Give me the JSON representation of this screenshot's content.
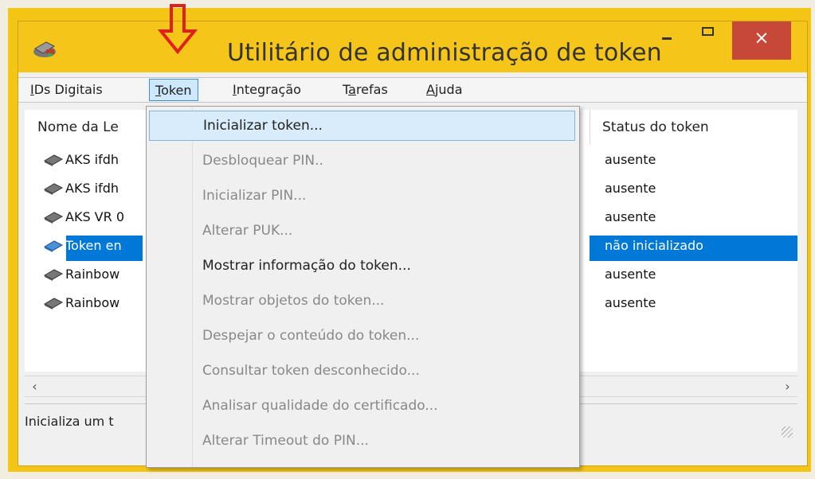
{
  "window": {
    "title": "Utilitário de administração de token",
    "close_glyph": "×"
  },
  "menubar": {
    "items": [
      {
        "id": "ids",
        "access": "I",
        "rest": "Ds Digitais"
      },
      {
        "id": "token",
        "access": "T",
        "rest": "oken"
      },
      {
        "id": "integ",
        "access": "I",
        "rest": "ntegração"
      },
      {
        "id": "tarefas",
        "pre": "T",
        "access": "a",
        "rest": "refas"
      },
      {
        "id": "ajuda",
        "access": "A",
        "rest": "juda"
      }
    ]
  },
  "table": {
    "col_name": "Nome da Le",
    "col_status": "Status do token",
    "rows": [
      {
        "name": "AKS ifdh",
        "status": "ausente",
        "icon": "token-reader-icon"
      },
      {
        "name": "AKS ifdh",
        "status": "ausente",
        "icon": "token-reader-icon"
      },
      {
        "name": "AKS VR 0",
        "status": "ausente",
        "icon": "token-reader-icon"
      },
      {
        "name": "Token en",
        "status": "não inicializado",
        "icon": "token-reader-blue-icon",
        "selected": true
      },
      {
        "name": "Rainbow",
        "status": "ausente",
        "icon": "token-reader-icon"
      },
      {
        "name": "Rainbow",
        "status": "ausente",
        "icon": "token-reader-icon"
      }
    ]
  },
  "scrollbar": {
    "left": "‹",
    "right": "›"
  },
  "statusbar": {
    "text": "Inicializa um t"
  },
  "dropdown": {
    "items": [
      {
        "label": "Inicializar token...",
        "enabled": true,
        "highlighted": true
      },
      {
        "label": "Desbloquear PIN..",
        "enabled": false
      },
      {
        "label": "Inicializar PIN...",
        "enabled": false
      },
      {
        "label": "Alterar PUK...",
        "enabled": false
      },
      {
        "label": "Mostrar informação do token...",
        "enabled": true
      },
      {
        "label": "Mostrar objetos do token...",
        "enabled": false
      },
      {
        "label": "Despejar o conteúdo do token...",
        "enabled": false
      },
      {
        "label": "Consultar token desconhecido...",
        "enabled": false
      },
      {
        "label": "Analisar qualidade do certificado...",
        "enabled": false
      },
      {
        "label": "Alterar Timeout do PIN...",
        "enabled": false
      }
    ]
  },
  "colors": {
    "frame": "#f5c516",
    "selection": "#0078d7",
    "close": "#c74739",
    "annotation_arrow": "#e0201b"
  }
}
